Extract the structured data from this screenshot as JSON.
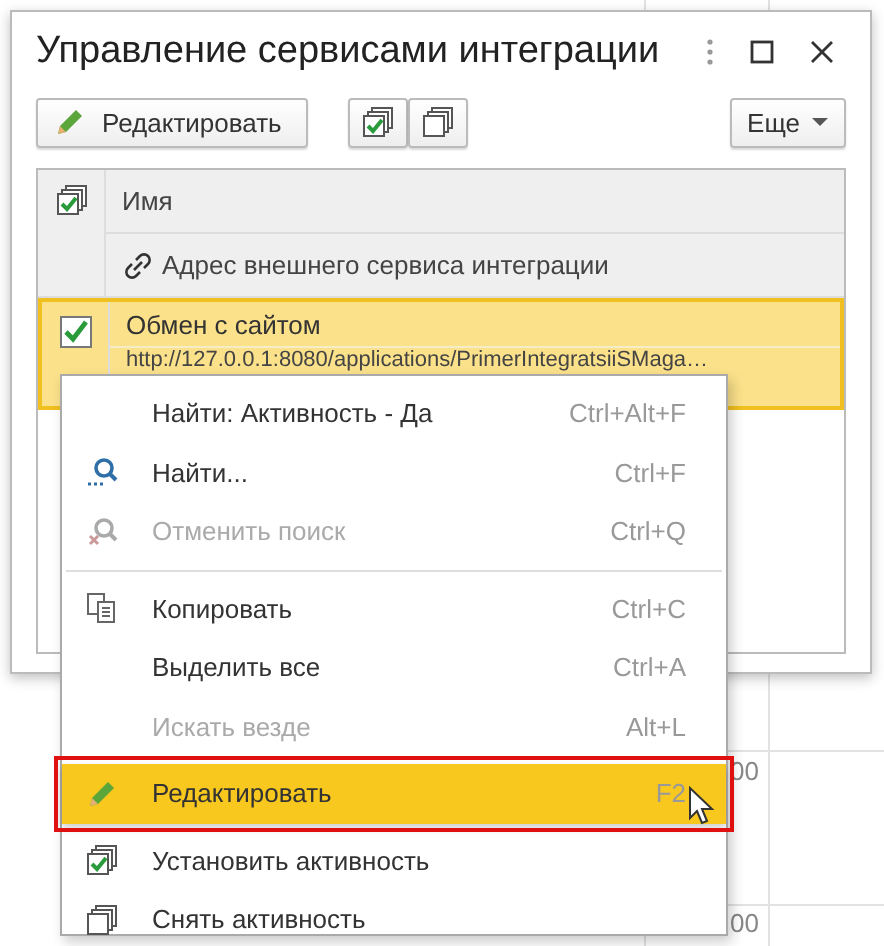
{
  "window": {
    "title": "Управление сервисами интеграции"
  },
  "toolbar": {
    "edit_button": "Редактировать",
    "more_button": "Еще"
  },
  "table": {
    "columns": [
      "Имя",
      "Адрес внешнего сервиса интеграции"
    ],
    "rows": [
      {
        "name": "Обмен с сайтом",
        "address": "http://127.0.0.1:8080/applications/PrimerIntegratsiiSMaga…",
        "active": true,
        "selected": true
      }
    ]
  },
  "background": {
    "cells": [
      "00",
      "00"
    ]
  },
  "context_menu": {
    "items": [
      {
        "kind": "plain",
        "label": "Найти: Активность - Да",
        "shortcut": "Ctrl+Alt+F",
        "disabled": false,
        "selected": false
      },
      {
        "kind": "find",
        "label": "Найти...",
        "shortcut": "Ctrl+F",
        "disabled": false,
        "selected": false
      },
      {
        "kind": "cancel-find",
        "label": "Отменить поиск",
        "shortcut": "Ctrl+Q",
        "disabled": true,
        "selected": false
      },
      {
        "kind": "separator"
      },
      {
        "kind": "copy",
        "label": "Копировать",
        "shortcut": "Ctrl+C",
        "disabled": false,
        "selected": false
      },
      {
        "kind": "plain",
        "label": "Выделить все",
        "shortcut": "Ctrl+A",
        "disabled": false,
        "selected": false
      },
      {
        "kind": "plain",
        "label": "Искать везде",
        "shortcut": "Alt+L",
        "disabled": true,
        "selected": false
      },
      {
        "kind": "edit",
        "label": "Редактировать",
        "shortcut": "F2",
        "disabled": false,
        "selected": true,
        "outlined": true
      },
      {
        "kind": "set-active",
        "label": "Установить активность",
        "disabled": false,
        "selected": false
      },
      {
        "kind": "clear-active",
        "label": "Снять активность",
        "disabled": false,
        "selected": false
      }
    ]
  }
}
